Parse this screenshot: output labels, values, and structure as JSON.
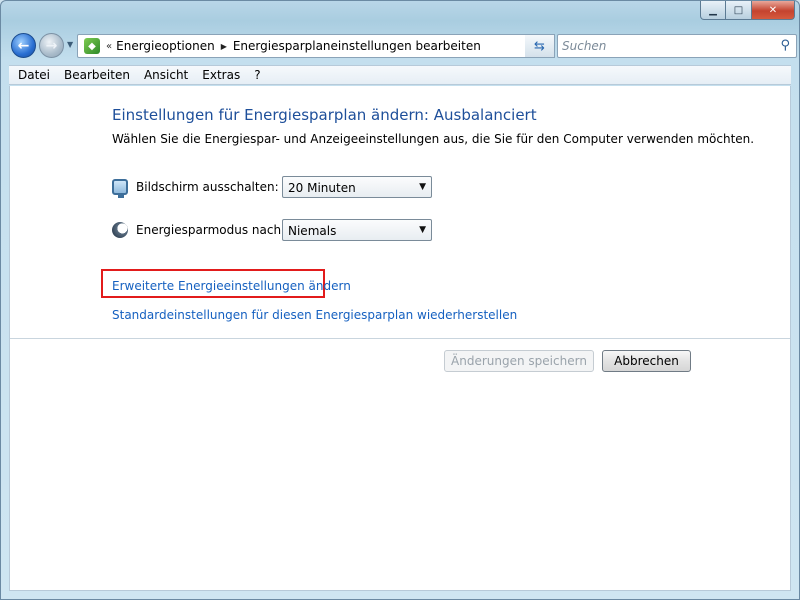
{
  "window": {
    "caption_buttons": {
      "minimize_icon": "minimize-icon",
      "maximize_icon": "maximize-icon",
      "close_icon": "close-icon"
    }
  },
  "nav": {
    "back_icon": "back-arrow-icon",
    "forward_icon": "forward-arrow-icon",
    "breadcrumb_prefix": "«",
    "breadcrumb": [
      "Energieoptionen",
      "Energiesparplaneinstellungen bearbeiten"
    ],
    "search_placeholder": "Suchen"
  },
  "menubar": {
    "items": [
      "Datei",
      "Bearbeiten",
      "Ansicht",
      "Extras",
      "?"
    ]
  },
  "main": {
    "title": "Einstellungen für Energiesparplan ändern: Ausbalanciert",
    "description": "Wählen Sie die Energiespar- und Anzeigeeinstellungen aus, die Sie für den Computer verwenden möchten.",
    "settings": [
      {
        "label": "Bildschirm ausschalten:",
        "value": "20 Minuten",
        "icon": "monitor-icon"
      },
      {
        "label": "Energiesparmodus nach:",
        "value": "Niemals",
        "icon": "sleep-moon-icon"
      }
    ],
    "links": {
      "advanced": "Erweiterte Energieeinstellungen ändern",
      "restore_defaults": "Standardeinstellungen für diesen Energiesparplan wiederherstellen"
    },
    "buttons": {
      "save": "Änderungen speichern",
      "cancel": "Abbrechen"
    }
  },
  "colors": {
    "title_blue": "#1e4f9a",
    "link_blue": "#1560c0",
    "highlight_red": "#e21b1b"
  }
}
